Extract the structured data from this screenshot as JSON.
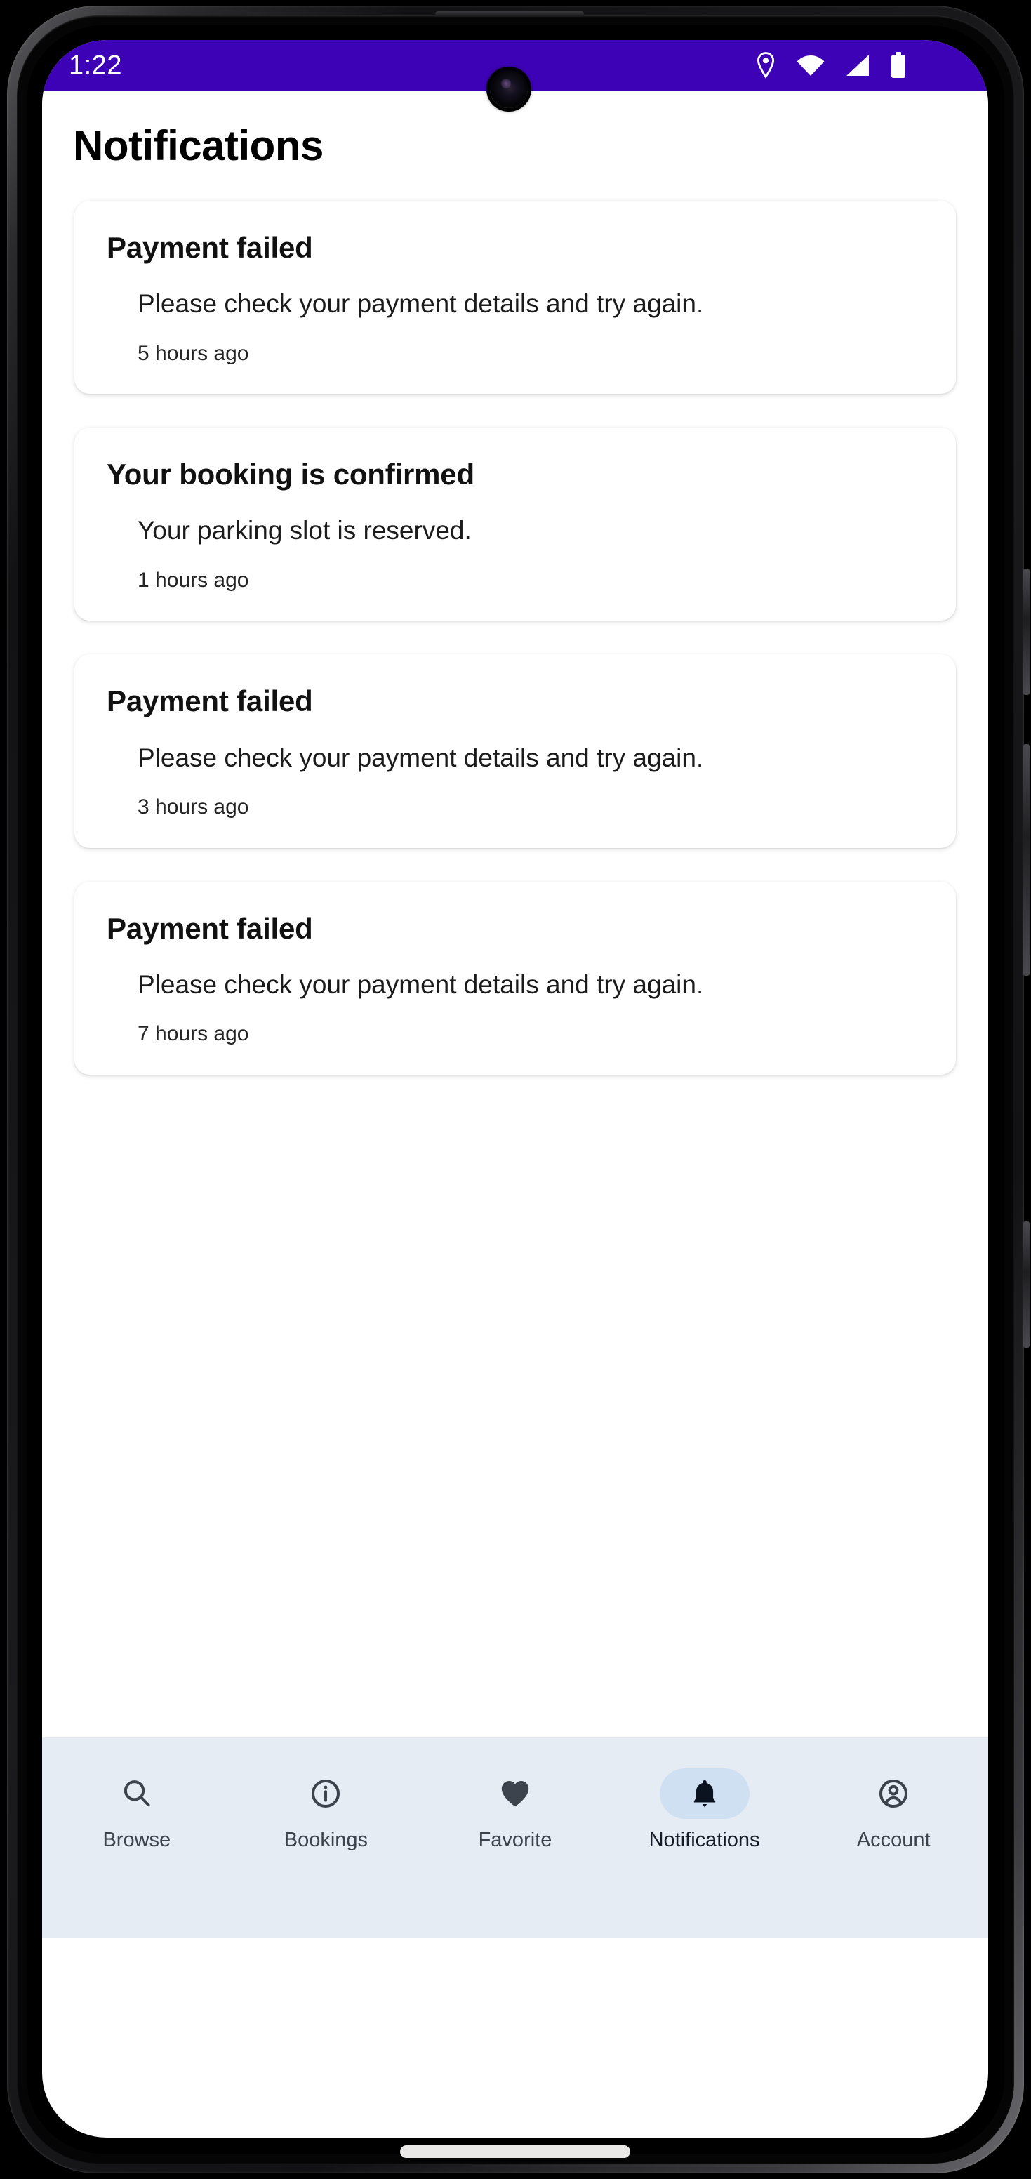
{
  "status_bar": {
    "time": "1:22",
    "background_color": "#3d02b5",
    "icons": [
      "location-pin-icon",
      "wifi-icon",
      "cellular-signal-icon",
      "battery-icon"
    ]
  },
  "header": {
    "title": "Notifications"
  },
  "notifications": [
    {
      "title": "Payment failed",
      "body": "Please check your payment details and try again.",
      "time": "5 hours ago"
    },
    {
      "title": "Your booking is confirmed",
      "body": "Your parking slot is reserved.",
      "time": "1 hours ago"
    },
    {
      "title": "Payment failed",
      "body": "Please check your payment details and try again.",
      "time": "3 hours ago"
    },
    {
      "title": "Payment failed",
      "body": "Please check your payment details and try again.",
      "time": "7 hours ago"
    }
  ],
  "bottom_nav": {
    "background_color": "#e6ecf4",
    "selected_pill_color": "#cfe0f2",
    "selected": "Notifications",
    "items": [
      {
        "label": "Browse",
        "icon": "search-icon",
        "selected": false
      },
      {
        "label": "Bookings",
        "icon": "info-circle-icon",
        "selected": false
      },
      {
        "label": "Favorite",
        "icon": "heart-icon",
        "selected": false
      },
      {
        "label": "Notifications",
        "icon": "bell-icon",
        "selected": true
      },
      {
        "label": "Account",
        "icon": "account-circle-icon",
        "selected": false
      }
    ]
  }
}
